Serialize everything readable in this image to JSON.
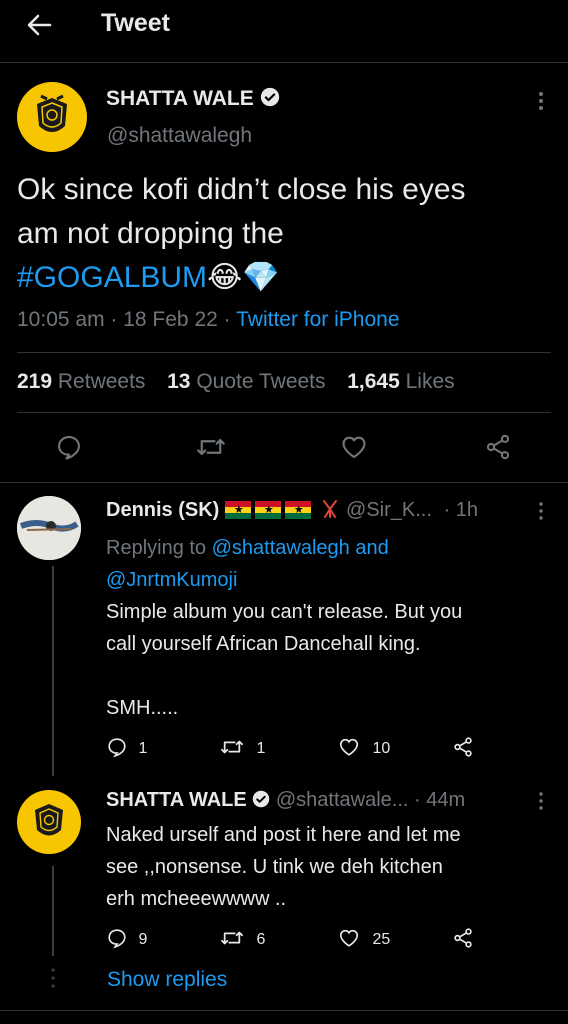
{
  "header": {
    "title": "Tweet"
  },
  "main_tweet": {
    "name": "SHATTA WALE",
    "handle": "@shattawalegh",
    "text_line1": "Ok since kofi didn’t close his eyes",
    "text_line2": "am not dropping the",
    "hashtag": "#GOGALBUM",
    "emojis": "😂💎",
    "time": "10:05 am",
    "date": "18 Feb 22",
    "source": "Twitter for iPhone",
    "retweets_count": "219",
    "retweets_label": "Retweets",
    "quotes_count": "13",
    "quotes_label": "Quote Tweets",
    "likes_count": "1,645",
    "likes_label": "Likes"
  },
  "reply1": {
    "name": "Dennis (SK)",
    "flags": "🇬🇭🇬🇭🇬🇭",
    "emoji": "🤸",
    "handle": "@Sir_K...",
    "time": "· 1h",
    "replying_prefix": "Replying to",
    "replying_to": "@shattawalegh and",
    "replying_to2": "@JnrtmKumoji",
    "text_line1": "Simple album you can't release. But you",
    "text_line2": "call yourself African Dancehall king.",
    "text_line3": "SMH.....",
    "replies": "1",
    "retweets": "1",
    "likes": "10"
  },
  "reply2": {
    "name": "SHATTA WALE",
    "handle": "@shattawale...",
    "time": "· 44m",
    "text_line1": "Naked urself and post it here and let me",
    "text_line2": "see ,,nonsense. U tink we deh kitchen",
    "text_line3": "erh mcheeewwww ..",
    "replies": "9",
    "retweets": "6",
    "likes": "25"
  },
  "show_replies": "Show replies",
  "colors": {
    "accent": "#1d9bf0",
    "background": "#000000",
    "muted": "#71767b",
    "avatar": "#f7c600"
  }
}
